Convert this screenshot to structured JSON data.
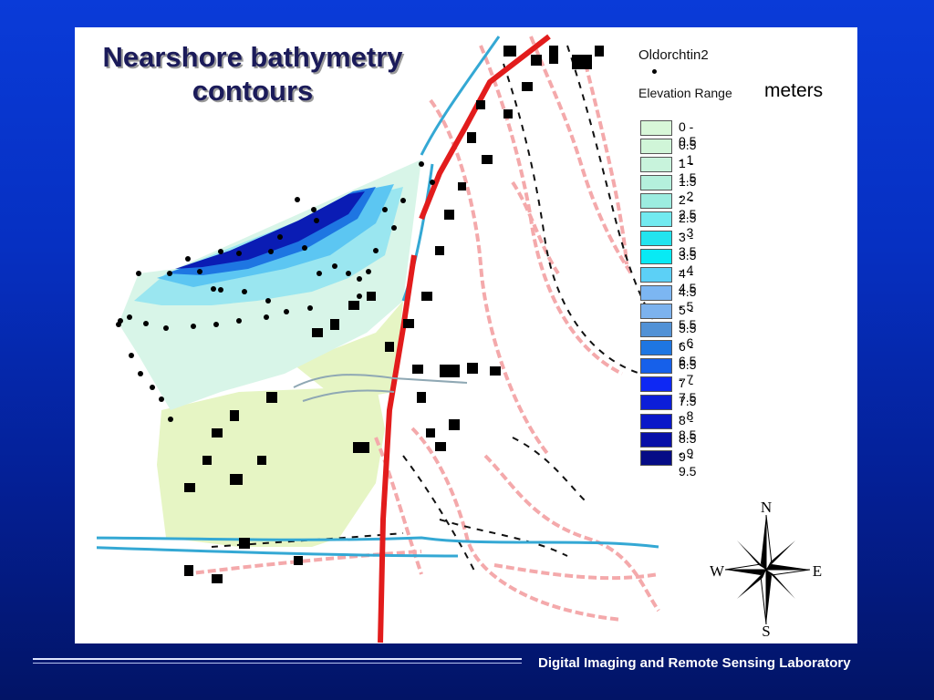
{
  "slide": {
    "title_lines": [
      "Nearshore bathymetry",
      "contours"
    ],
    "footer": "Digital Imaging and Remote Sensing Laboratory"
  },
  "legend": {
    "layer_name": "Oldorchtin2",
    "range_label": "Elevation Range",
    "units": "meters",
    "classes": [
      {
        "label": "0 - 0.5",
        "color": "#d8f7d8"
      },
      {
        "label": "0.5 - 1",
        "color": "#d0f5d8"
      },
      {
        "label": "1 - 1.5",
        "color": "#c8f3dc"
      },
      {
        "label": "1.5 - 2",
        "color": "#b4f0dc"
      },
      {
        "label": "2 - 2.5",
        "color": "#9cece0"
      },
      {
        "label": "2.5 - 3",
        "color": "#72eaf0"
      },
      {
        "label": "3 - 3.5",
        "color": "#22e4ee"
      },
      {
        "label": "3.5 - 4",
        "color": "#08eaf4"
      },
      {
        "label": "4 - 4.5",
        "color": "#5cd0f6"
      },
      {
        "label": "4.5 - 5",
        "color": "#7cb6f2"
      },
      {
        "label": "5 - 5.5",
        "color": "#7cb2ee"
      },
      {
        "label": "5.5 - 6",
        "color": "#5292d6"
      },
      {
        "label": "6 - 6.5",
        "color": "#1e76e2"
      },
      {
        "label": "6.5 - 7",
        "color": "#1660ea"
      },
      {
        "label": "7 - 7.5",
        "color": "#0e28f4"
      },
      {
        "label": "7.5 - 8",
        "color": "#0c1ed8"
      },
      {
        "label": "8 - 8.5",
        "color": "#0a18c8"
      },
      {
        "label": "8.5 - 9",
        "color": "#0810a8"
      },
      {
        "label": "9 - 9.5",
        "color": "#060c86"
      }
    ]
  },
  "compass": {
    "n": "N",
    "s": "S",
    "e": "E",
    "w": "W"
  },
  "colors": {
    "background": "#0630c2",
    "land_green": "#e6f5c4",
    "road_red": "#e21c1c",
    "contour_pink": "#f4a9ab",
    "building": "#000000"
  }
}
